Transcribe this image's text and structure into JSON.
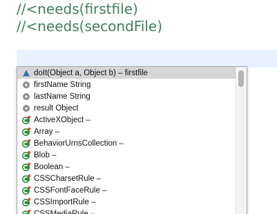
{
  "editor": {
    "lines": [
      "//<needs(firstfile)",
      "//<needs(secondFile)"
    ]
  },
  "completion": {
    "items": [
      {
        "label": "doIt(Object a, Object b) – firstfile",
        "icon": "method-triangle-icon",
        "selected": true
      },
      {
        "label": "firstName String",
        "icon": "field-circle-icon"
      },
      {
        "label": "lastName String",
        "icon": "field-circle-icon"
      },
      {
        "label": "result Object",
        "icon": "field-circle-icon"
      },
      {
        "label": "ActiveXObject –",
        "icon": "class-c-icon"
      },
      {
        "label": "Array –",
        "icon": "class-c-icon"
      },
      {
        "label": "BehaviorUrnsCollection –",
        "icon": "class-c-icon"
      },
      {
        "label": "Blob –",
        "icon": "class-c-icon"
      },
      {
        "label": "Boolean –",
        "icon": "class-c-icon"
      },
      {
        "label": "CSSCharsetRule –",
        "icon": "class-c-icon"
      },
      {
        "label": "CSSFontFaceRule –",
        "icon": "class-c-icon"
      },
      {
        "label": "CSSImportRule –",
        "icon": "class-c-icon"
      },
      {
        "label": "CSSMediaRule –",
        "icon": "class-c-icon"
      }
    ]
  },
  "colors": {
    "comment": "#3f7f5f",
    "current_line": "#e8f2fe",
    "selection": "#d6d6d6",
    "method_icon": "#2f6fb3",
    "field_icon": "#8e8e8e",
    "class_icon": "#2e8b3a"
  }
}
